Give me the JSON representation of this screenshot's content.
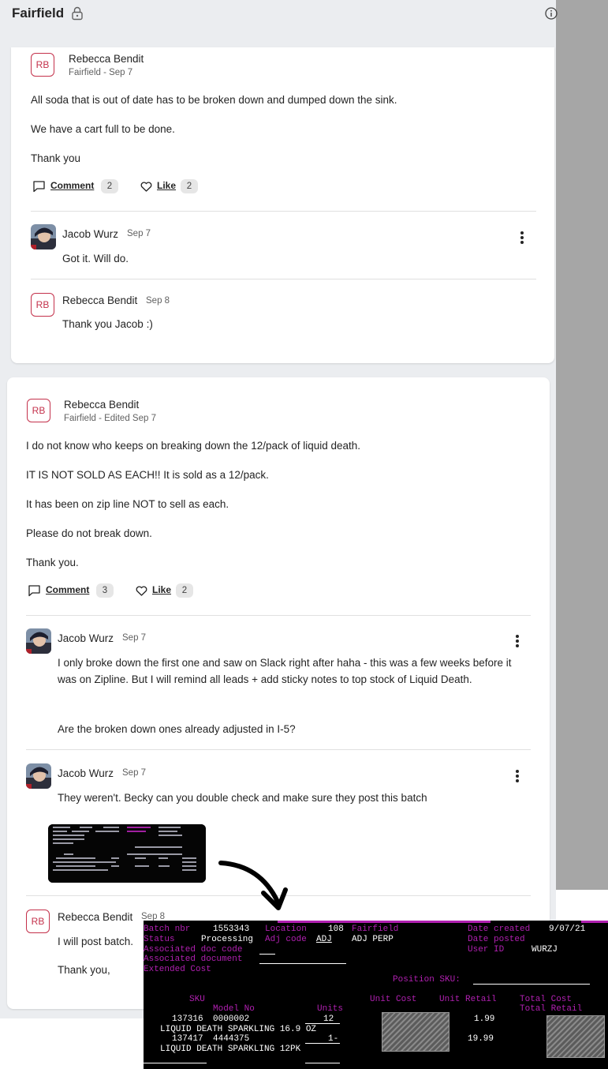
{
  "header": {
    "title": "Fairfield",
    "icons": [
      "lock-icon",
      "info-icon"
    ]
  },
  "post1": {
    "author": "Rebecca Bendit",
    "initials": "RB",
    "meta": "Fairfield - Sep 7",
    "paragraphs": [
      "All soda that is out of date has to be broken down and dumped down the sink.",
      "We have a cart full to be done.",
      "Thank you"
    ],
    "comment_label": "Comment",
    "comment_count": "2",
    "like_label": "Like",
    "like_count": "2",
    "replies": [
      {
        "author": "Jacob Wurz",
        "date": "Sep 7",
        "text": "Got it. Will do."
      },
      {
        "author": "Rebecca Bendit",
        "initials": "RB",
        "date": "Sep 8",
        "text": "Thank you Jacob :)"
      }
    ]
  },
  "post2": {
    "author": "Rebecca Bendit",
    "initials": "RB",
    "meta": "Fairfield - Edited Sep 7",
    "paragraphs": [
      "I do not know who keeps on breaking down the 12/pack of liquid death.",
      "IT IS NOT SOLD AS EACH!! It is sold as a 12/pack.",
      "It has been on zip line NOT to sell as each.",
      "Please do not break down.",
      "Thank you."
    ],
    "comment_label": "Comment",
    "comment_count": "3",
    "like_label": "Like",
    "like_count": "2",
    "replies": [
      {
        "author": "Jacob Wurz",
        "date": "Sep 7",
        "text": "I only broke down the first one and saw on Slack right after haha - this was a few weeks before it was on Zipline. But I will remind all leads + add sticky notes to top stock of Liquid Death.",
        "text2": "Are the broken down ones already adjusted in I-5?"
      },
      {
        "author": "Jacob Wurz",
        "date": "Sep 7",
        "text": "They weren't. Becky can you double check and make sure they post this batch"
      },
      {
        "author": "Rebecca Bendit",
        "initials": "RB",
        "date": "Sep 8",
        "text": "I will post batch.",
        "text2": "Thank you,"
      }
    ]
  },
  "terminal": {
    "batch_label": "Batch nbr",
    "batch_value": "1553343",
    "location_label": "Location",
    "location_num": "108",
    "location_name": "Fairfield",
    "date_created_label": "Date created",
    "date_created_value": "9/07/21",
    "status_label": "Status",
    "status_value": "Processing",
    "adj_label": "Adj code",
    "adj_value": "ADJ",
    "adj_desc": "ADJ PERP",
    "date_posted_label": "Date posted",
    "user_label": "User ID",
    "user_value": "WURZJ",
    "assoc_doc_code": "Associated doc code",
    "assoc_document": "Associated document",
    "extended_cost": "Extended Cost",
    "position_sku": "Position SKU:",
    "col_sku": "SKU",
    "col_model": "Model No",
    "col_units": "Units",
    "col_unit_cost": "Unit Cost",
    "col_unit_retail": "Unit Retail",
    "col_total_cost": "Total Cost",
    "col_total_retail": "Total Retail",
    "rows": [
      {
        "sku": "137316",
        "model": "0000002",
        "units": "12",
        "retail": "1.99",
        "desc": "LIQUID DEATH SPARKLING 16.9 OZ"
      },
      {
        "sku": "137417",
        "model": "4444375",
        "units": "1-",
        "retail": "19.99",
        "desc": "LIQUID DEATH SPARKLING 12PK"
      }
    ]
  }
}
